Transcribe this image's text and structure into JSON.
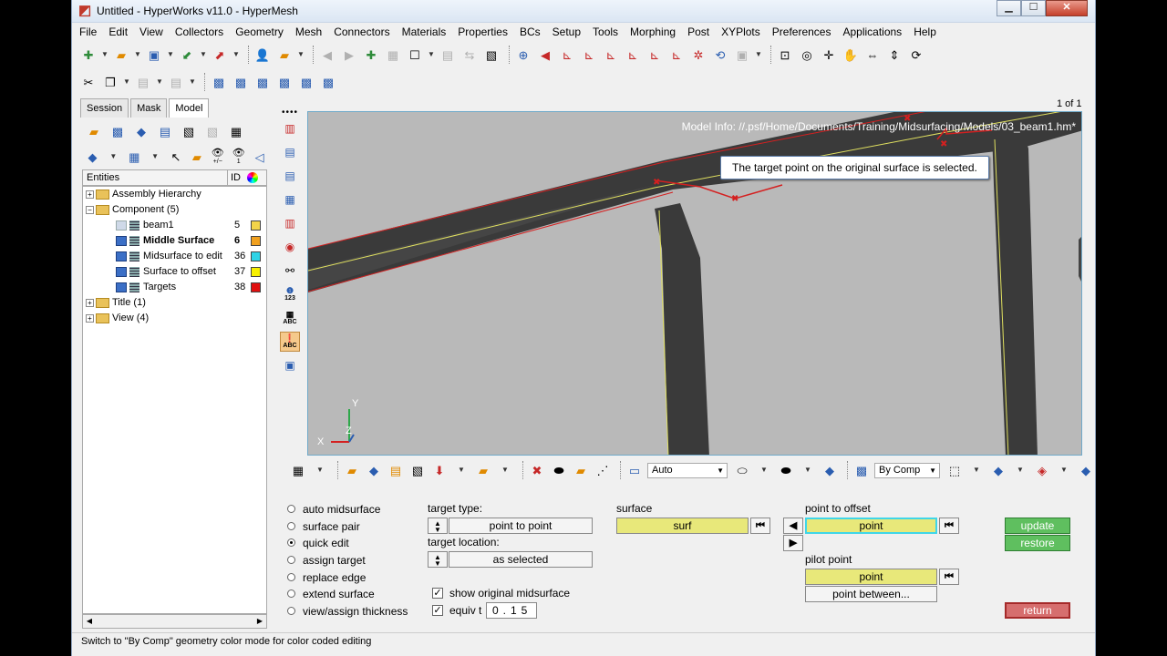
{
  "window": {
    "title": "Untitled - HyperWorks v11.0 - HyperMesh",
    "minimize": "▁",
    "maximize": "☐",
    "close": "✕"
  },
  "menu": [
    "File",
    "Edit",
    "View",
    "Collectors",
    "Geometry",
    "Mesh",
    "Connectors",
    "Materials",
    "Properties",
    "BCs",
    "Setup",
    "Tools",
    "Morphing",
    "Post",
    "XYPlots",
    "Preferences",
    "Applications",
    "Help"
  ],
  "browser": {
    "tabs": [
      "Session",
      "Mask",
      "Model"
    ],
    "active_tab": "Model",
    "header": {
      "entities": "Entities",
      "id": "ID"
    },
    "tree": [
      {
        "label": "Assembly Hierarchy"
      },
      {
        "label": "Component (5)"
      },
      {
        "label": "beam1",
        "id": "5",
        "color": "#f2d44a"
      },
      {
        "label": "Middle Surface",
        "id": "6",
        "color": "#f0a01e"
      },
      {
        "label": "Midsurface to edit",
        "id": "36",
        "color": "#2ed3e6"
      },
      {
        "label": "Surface to offset",
        "id": "37",
        "color": "#f7f000"
      },
      {
        "label": "Targets",
        "id": "38",
        "color": "#e01010"
      },
      {
        "label": "Title (1)"
      },
      {
        "label": "View (4)"
      }
    ],
    "tool_labels": {
      "eye_plus_minus": "+/−",
      "eye_one": "1"
    }
  },
  "vtools_text": {
    "numbers": "123",
    "abc": "ABC",
    "abc2": "ABC"
  },
  "viewport": {
    "page_count": "1 of 1",
    "model_info": "Model Info: //.psf/Home/Documents/Training/Midsurfacing/Models/03_beam1.hm*",
    "tooltip": "The target point on the original surface is selected.",
    "axis_y": "Y",
    "axis_z": "Z",
    "axis_x": "X"
  },
  "bottom_toolbar": {
    "display_mode": "Auto",
    "color_mode": "By Comp"
  },
  "panel": {
    "modes": [
      "auto midsurface",
      "surface pair",
      "quick edit",
      "assign target",
      "replace edge",
      "extend surface",
      "view/assign thickness"
    ],
    "selected_mode": "quick edit",
    "target_type_label": "target type:",
    "target_type_value": "point to point",
    "target_location_label": "target location:",
    "target_location_value": "as selected",
    "show_original_label": "show original midsurface",
    "show_original_checked": true,
    "equiv_label": "equiv t",
    "equiv_checked": true,
    "equiv_value": "0.15",
    "surface_label": "surface",
    "surface_btn": "surf",
    "point_to_offset_label": "point to offset",
    "point_to_offset_btn": "point",
    "pilot_point_label": "pilot point",
    "pilot_point_btn": "point",
    "point_between_btn": "point between...",
    "update": "update",
    "restore": "restore",
    "return": "return"
  },
  "status": "Switch to \"By Comp\" geometry color mode for color coded editing"
}
